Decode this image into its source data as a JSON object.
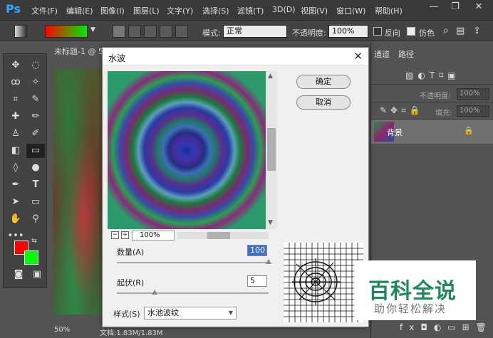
{
  "app": {
    "logo": "Ps"
  },
  "menu": [
    "文件(F)",
    "编辑(E)",
    "图像(I)",
    "图层(L)",
    "文字(Y)",
    "选择(S)",
    "滤镜(T)",
    "3D(D)",
    "视图(V)",
    "窗口(W)",
    "帮助(H)"
  ],
  "window_controls": {
    "minimize": "—",
    "restore": "❐",
    "close": "✕"
  },
  "options": {
    "mode_label": "模式:",
    "mode_value": "正常",
    "opacity_label": "不透明度:",
    "opacity_value": "100%",
    "reverse_label": "反向",
    "dither_label": "仿色",
    "reverse_checked": false,
    "dither_checked": true,
    "gradient_colors": [
      "#ff0000",
      "#00ee00"
    ]
  },
  "document": {
    "tab_title": "未标题-1 @ 5",
    "zoom": "50%",
    "status": "文档:1.83M/1.83M"
  },
  "panels": {
    "tabs": [
      "通道",
      "路径"
    ],
    "opacity_label": "不透明度:",
    "opacity_value": "100%",
    "fill_label": "填充:",
    "fill_value": "100%",
    "layer_name": "背景"
  },
  "dialog": {
    "title": "水波",
    "ok": "确定",
    "cancel": "取消",
    "zoom": "100%",
    "amount_label": "数量(A)",
    "amount_value": "100",
    "amount_fraction": 1.0,
    "ridges_label": "起伏(R)",
    "ridges_value": "5",
    "ridges_fraction": 0.25,
    "style_label": "样式(S)",
    "style_value": "水池波纹"
  },
  "watermark": {
    "title": "百科全说",
    "subtitle": "助你轻松解决"
  },
  "colors": {
    "foreground": "#ff0000",
    "background": "#00ff00",
    "accent": "#31a8ff"
  }
}
